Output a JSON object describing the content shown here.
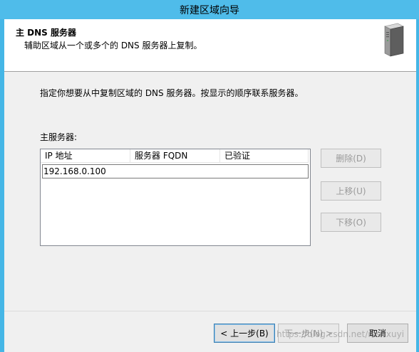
{
  "window": {
    "title": "新建区域向导"
  },
  "header": {
    "title": "主 DNS 服务器",
    "subtitle": "辅助区域从一个或多个的 DNS 服务器上复制。",
    "icon": "server-icon"
  },
  "main": {
    "instruction": "指定你想要从中复制区域的 DNS 服务器。按显示的顺序联系服务器。",
    "list_label": "主服务器:",
    "columns": [
      "IP 地址",
      "服务器 FQDN",
      "已验证"
    ],
    "rows": [
      {
        "ip": "192.168.0.100",
        "fqdn": "",
        "verified": ""
      }
    ]
  },
  "side_buttons": {
    "delete": "删除(D)",
    "move_up": "上移(U)",
    "move_down": "下移(O)"
  },
  "footer": {
    "back": "< 上一步(B)",
    "next": "下一步(N) >",
    "cancel": "取消"
  },
  "watermark": "https://blog.csdn.net/mshxuyi",
  "colors": {
    "titlebar": "#4fbcea",
    "frame": "#45b6e6",
    "dialog": "#f0f0f0"
  }
}
